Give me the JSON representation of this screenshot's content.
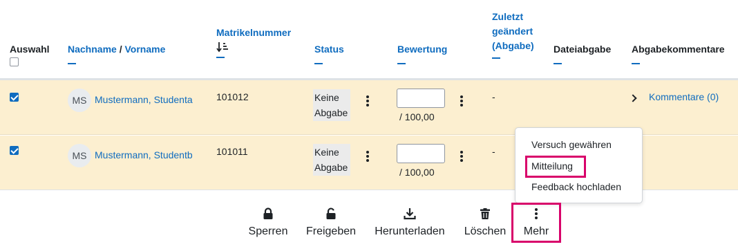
{
  "header": {
    "select": "Auswahl",
    "lastname": "Nachname",
    "slash": " / ",
    "firstname": "Vorname",
    "matrikel": "Matrikelnummer",
    "status": "Status",
    "grade": "Bewertung",
    "modified_1": "Zuletzt",
    "modified_2": "geändert",
    "modified_3": "(Abgabe)",
    "file": "Dateiabgabe",
    "comments": "Abgabekommentare"
  },
  "rows": [
    {
      "initials": "MS",
      "name": "Mustermann, Studenta",
      "matrikel": "101012",
      "status_1": "Keine",
      "status_2": "Abgabe",
      "grade_value": "",
      "grade_max": "/ 100,00",
      "modified": "-",
      "comments": "Kommentare (0)",
      "selected": true
    },
    {
      "initials": "MS",
      "name": "Mustermann, Studentb",
      "matrikel": "101011",
      "status_1": "Keine",
      "status_2": "Abgabe",
      "grade_value": "",
      "grade_max": "/ 100,00",
      "modified": "-",
      "selected": true
    }
  ],
  "more_menu": {
    "items": [
      "Versuch gewähren",
      "Mitteilung",
      "Feedback hochladen"
    ],
    "highlighted": "Mitteilung"
  },
  "actions": {
    "lock": "Sperren",
    "unlock": "Freigeben",
    "download": "Herunterladen",
    "delete": "Löschen",
    "more": "Mehr"
  },
  "colors": {
    "link": "#0f6cbf",
    "row_selected": "#fcefd0",
    "highlight": "#d8006a"
  },
  "icons": {
    "sort": "sort-descending-icon",
    "lock": "lock-icon",
    "unlock": "unlock-icon",
    "download": "download-icon",
    "delete": "trash-icon",
    "more": "kebab-icon"
  }
}
